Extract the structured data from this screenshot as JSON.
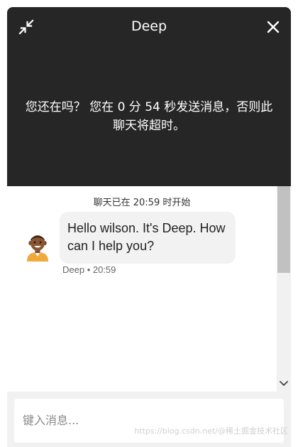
{
  "header": {
    "title": "Deep",
    "timeout_message": "您还在吗？ 您在 0 分 54 秒发送消息，否则此聊天将超时。",
    "minimize_icon": "minimize-icon",
    "close_icon": "close-icon",
    "background": "#262626"
  },
  "chat": {
    "start_note": "聊天已在 20:59 时开始",
    "messages": [
      {
        "text": "Hello wilson. It's Deep. How can I help you?",
        "meta": "Deep • 20:59",
        "avatar_icon": "agent-avatar-icon"
      }
    ]
  },
  "composer": {
    "placeholder": "键入消息..."
  },
  "watermark": "https://blog.csdn.net/@稀土掘金技术社区"
}
